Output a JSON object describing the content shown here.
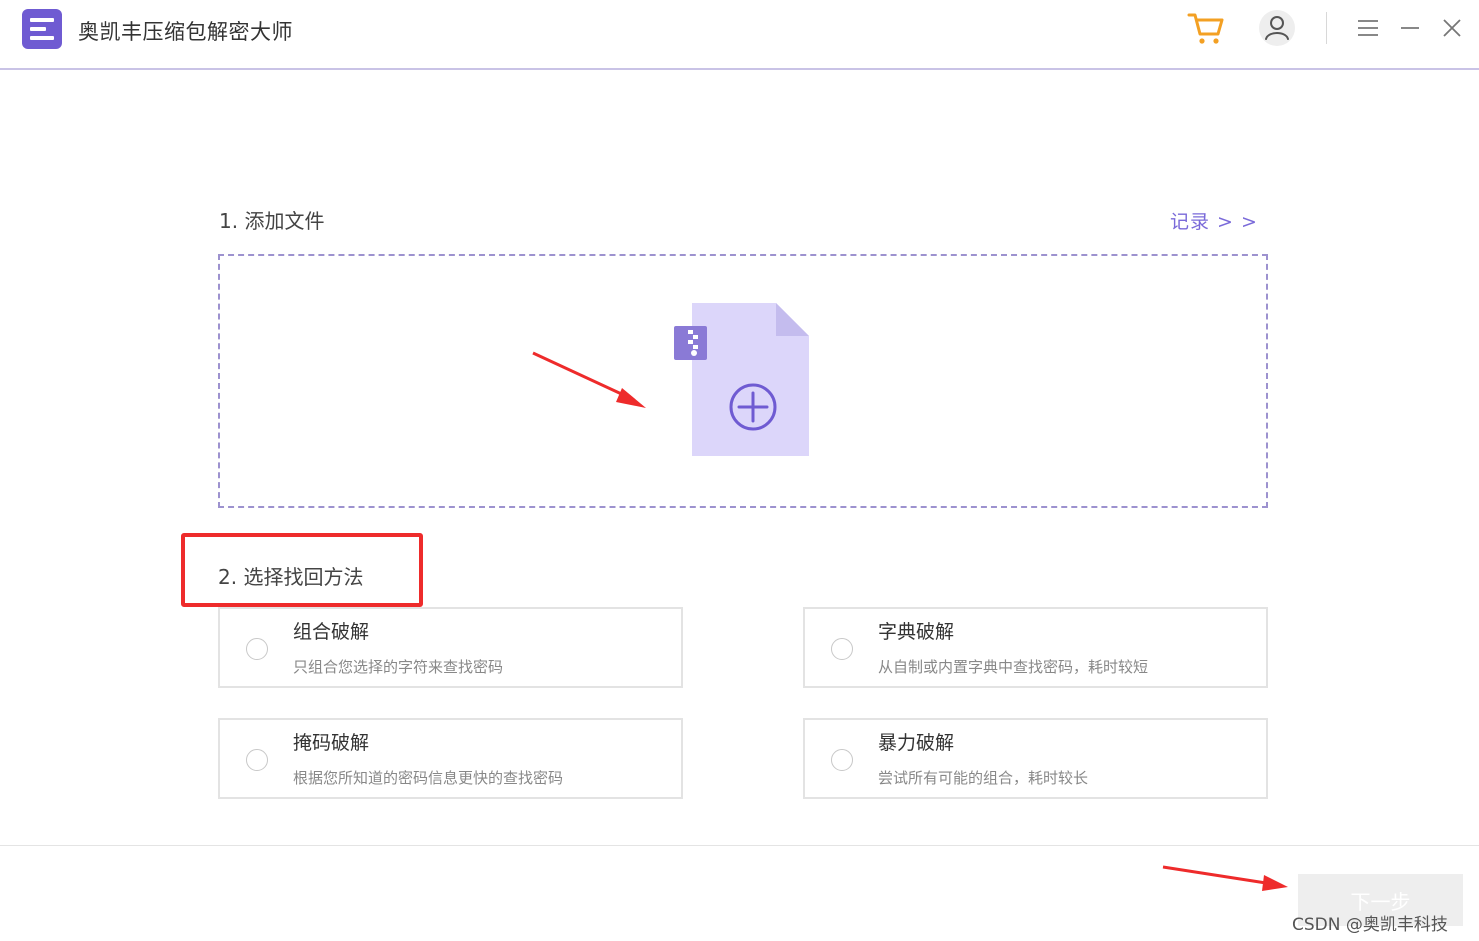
{
  "app": {
    "title": "奥凯丰压缩包解密大师"
  },
  "colors": {
    "accent": "#6f5bd2",
    "cart": "#f3a023",
    "highlight": "#ee2b2b"
  },
  "titlebar": {
    "icons": [
      "cart-icon",
      "user-icon",
      "menu-icon",
      "minimize-icon",
      "close-icon"
    ]
  },
  "step1": {
    "label": "1. 添加文件",
    "record_link": "记录 > >"
  },
  "step2": {
    "label": "2. 选择找回方法"
  },
  "options": [
    {
      "title": "组合破解",
      "desc": "只组合您选择的字符来查找密码"
    },
    {
      "title": "字典破解",
      "desc": "从自制或内置字典中查找密码，耗时较短"
    },
    {
      "title": "掩码破解",
      "desc": "根据您所知道的密码信息更快的查找密码"
    },
    {
      "title": "暴力破解",
      "desc": "尝试所有可能的组合，耗时较长"
    }
  ],
  "footer": {
    "next_label": "下一步",
    "watermark": "CSDN @奥凯丰科技"
  }
}
